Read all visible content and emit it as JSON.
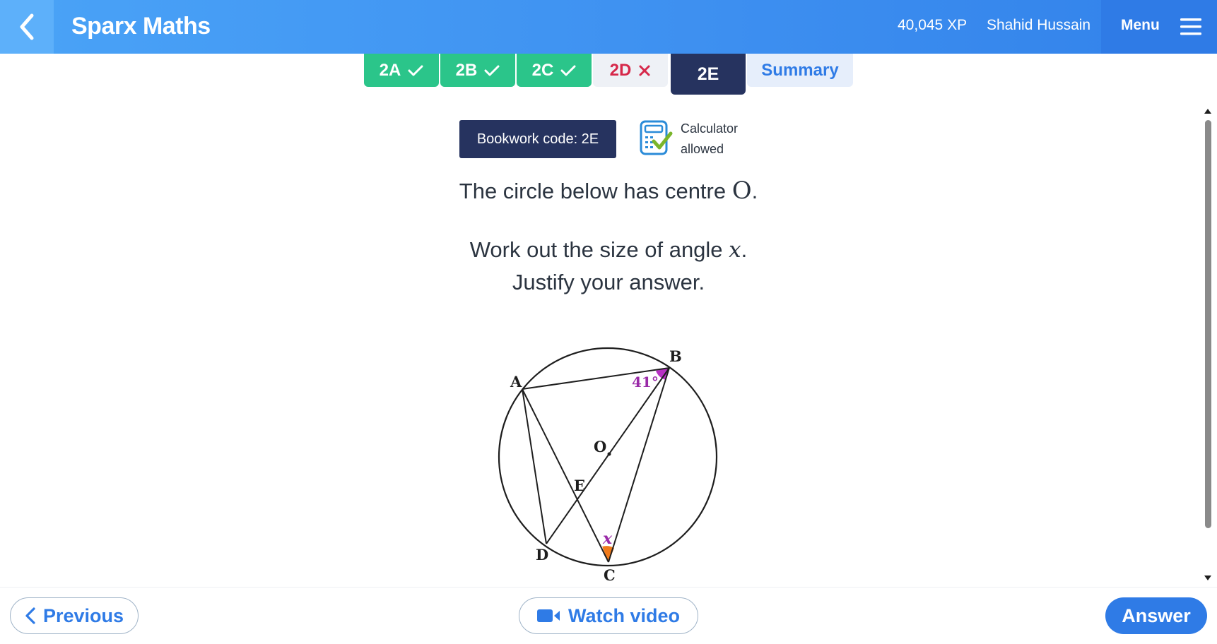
{
  "header": {
    "title": "Sparx Maths",
    "xp": "40,045 XP",
    "user_name": "Shahid Hussain",
    "menu_label": "Menu"
  },
  "tabs": [
    {
      "label": "2A",
      "status": "correct"
    },
    {
      "label": "2B",
      "status": "correct"
    },
    {
      "label": "2C",
      "status": "correct"
    },
    {
      "label": "2D",
      "status": "incorrect"
    },
    {
      "label": "2E",
      "status": "current"
    },
    {
      "label": "Summary",
      "status": "summary"
    }
  ],
  "bookwork": {
    "code_label": "Bookwork code: 2E",
    "calculator_line1": "Calculator",
    "calculator_line2": "allowed"
  },
  "question": {
    "line1_text": "The circle below has centre ",
    "line1_symbol": "O",
    "line1_end": ".",
    "line2_text": "Work out the size of angle ",
    "line2_symbol": "x",
    "line2_end": ".",
    "line3": "Justify your answer."
  },
  "diagram": {
    "points": {
      "A": "A",
      "B": "B",
      "C": "C",
      "D": "D",
      "E": "E",
      "O": "O"
    },
    "given_angle": "41°",
    "unknown_angle": "x"
  },
  "footer": {
    "previous_label": "Previous",
    "watch_video_label": "Watch video",
    "answer_label": "Answer"
  },
  "colors": {
    "header_blue": "#3d8ff0",
    "tab_done": "#2bc58a",
    "tab_wrong_text": "#d6284a",
    "tab_active": "#26335f",
    "angle_given": "#b832c4",
    "angle_unknown": "#f07a1a",
    "button_blue": "#2f7be6"
  },
  "icons": [
    "back-chevron-icon",
    "menu-icon",
    "check-icon",
    "cross-icon",
    "calculator-icon",
    "chevron-left-icon",
    "video-camera-icon"
  ]
}
